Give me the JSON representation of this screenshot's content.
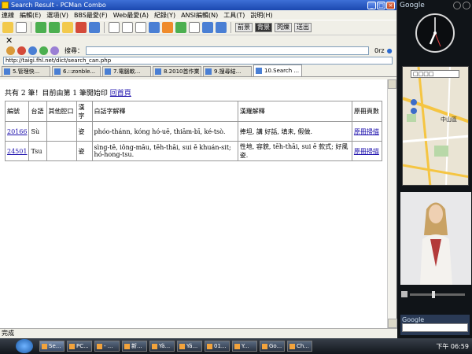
{
  "window": {
    "title": "Search Result - PCMan Combo"
  },
  "menu": [
    "連線",
    "編輯(E)",
    "選項(V)",
    "BBS最愛(F)",
    "Web最愛(A)",
    "紀錄(Y)",
    "ANSI編輯(N)",
    "工具(T)",
    "說明(H)"
  ],
  "toolbar": {
    "btn_1": "前景",
    "btn_2": "背景",
    "btn_3": "閃爍",
    "btn_4": "送出"
  },
  "search": {
    "label": "搜尋：",
    "value": "",
    "right": "0rz"
  },
  "address": {
    "value": "http://taigi.fhl.net/dict/search_can.php"
  },
  "tabs": [
    {
      "label": "5.管理快..."
    },
    {
      "label": "6.::zonble..."
    },
    {
      "label": "7.電腦軟..."
    },
    {
      "label": "8.2010首作業"
    },
    {
      "label": "9.搜尋結..."
    },
    {
      "label": "10.Search ..."
    }
  ],
  "results": {
    "summary": "共有 2 筆！目前由第 1 筆開始印",
    "back_link": "回首頁",
    "headers": [
      "編號",
      "台語",
      "其他腔口",
      "漢字",
      "白話字解釋",
      "漢羅解釋",
      "原冊頁數"
    ],
    "rows": [
      {
        "id": "20166",
        "taiyu": "Sù",
        "other": "",
        "hanzi": "姿",
        "poj": "phóo-thánn, kóng hó-uē, thiām-bī, ké-tsò.",
        "hanlo": "捧坦, 講 好話, 填未, 假做.",
        "page": "原冊掃描"
      },
      {
        "id": "24501",
        "taiyu": "Tsu",
        "other": "",
        "hanzi": "姿",
        "poj": "sìng-tē, iông-māu, tēh-thāi, sui ē khuán-sit; hó-hong-tsu.",
        "hanlo": "性地, 容貌, tēh-thāi, sui ē 款式; 好風姿.",
        "page": "原冊掃描"
      }
    ]
  },
  "status": "完成",
  "sidebar": {
    "gadget_title": "Google",
    "map_select": "□□□□",
    "map_label": "中山區",
    "search_title": "Google"
  },
  "taskbar": {
    "tasks": [
      "Se...",
      "PC...",
      "- ...",
      "新...",
      "Yä...",
      "Yä...",
      "01...",
      "Y...",
      "Go...",
      "Ch..."
    ],
    "clock": "下午 06:59"
  }
}
